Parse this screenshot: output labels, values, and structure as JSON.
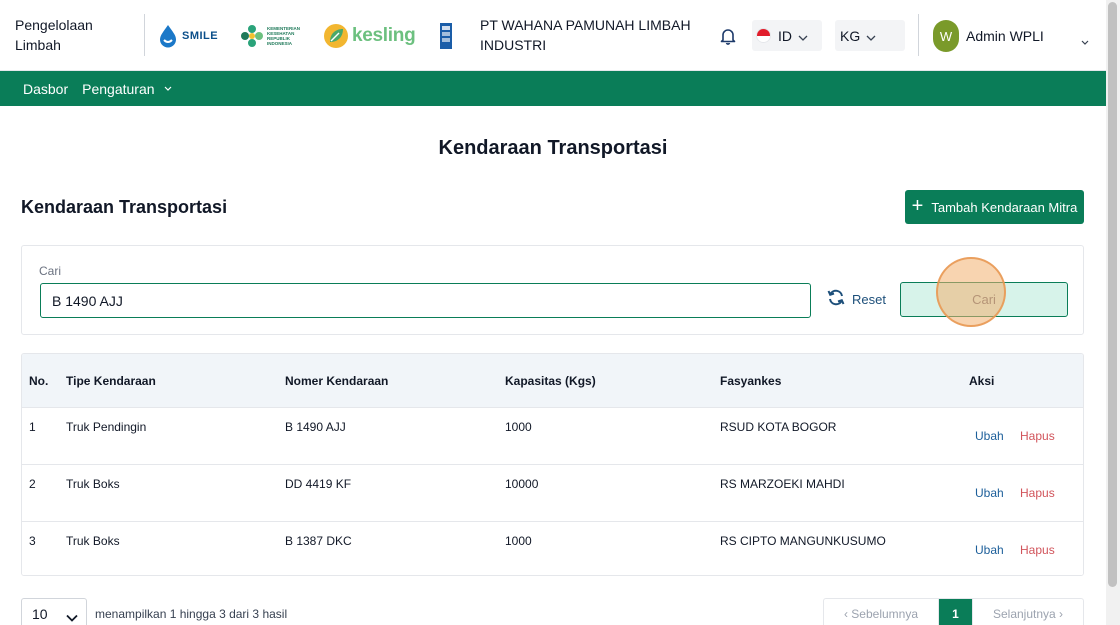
{
  "header": {
    "app_title": "Pengelolaan Limbah",
    "logos": {
      "smile": "SMILE",
      "kemenkes": "KEMENTERIAN KESEHATAN REPUBLIK INDONESIA",
      "kesling": "kesling"
    },
    "company": "PT WAHANA PAMUNAH LIMBAH INDUSTRI",
    "language": "ID",
    "unit": "KG",
    "user_initial": "W",
    "user_name": "Admin WPLI"
  },
  "nav": {
    "dashboard": "Dasbor",
    "settings": "Pengaturan"
  },
  "page": {
    "title": "Kendaraan Transportasi",
    "section_title": "Kendaraan Transportasi",
    "add_button": "Tambah Kendaraan Mitra"
  },
  "search": {
    "label": "Cari",
    "value": "B 1490 AJJ",
    "reset_label": "Reset",
    "submit_label": "Cari"
  },
  "table": {
    "headers": {
      "no": "No.",
      "type": "Tipe Kendaraan",
      "plate": "Nomer Kendaraan",
      "capacity": "Kapasitas (Kgs)",
      "facility": "Fasyankes",
      "action": "Aksi"
    },
    "rows": [
      {
        "no": "1",
        "type": "Truk Pendingin",
        "plate": "B 1490 AJJ",
        "capacity": "1000",
        "facility": "RSUD KOTA BOGOR",
        "edit": "Ubah",
        "delete": "Hapus"
      },
      {
        "no": "2",
        "type": "Truk Boks",
        "plate": "DD 4419 KF",
        "capacity": "10000",
        "facility": "RS MARZOEKI MAHDI",
        "edit": "Ubah",
        "delete": "Hapus"
      },
      {
        "no": "3",
        "type": "Truk Boks",
        "plate": "B 1387 DKC",
        "capacity": "1000",
        "facility": "RS CIPTO MANGUNKUSUMO",
        "edit": "Ubah",
        "delete": "Hapus"
      }
    ]
  },
  "footer": {
    "page_size": "10",
    "showing_text": "menampilkan 1 hingga 3 dari 3 hasil",
    "prev_label": "‹  Sebelumnya",
    "current_page": "1",
    "next_label": "Selanjutnya  ›"
  },
  "colors": {
    "brand_green": "#0a7d58",
    "link_blue": "#1d5f9a",
    "danger_red": "#d1545b",
    "avatar": "#7a9a2a"
  }
}
